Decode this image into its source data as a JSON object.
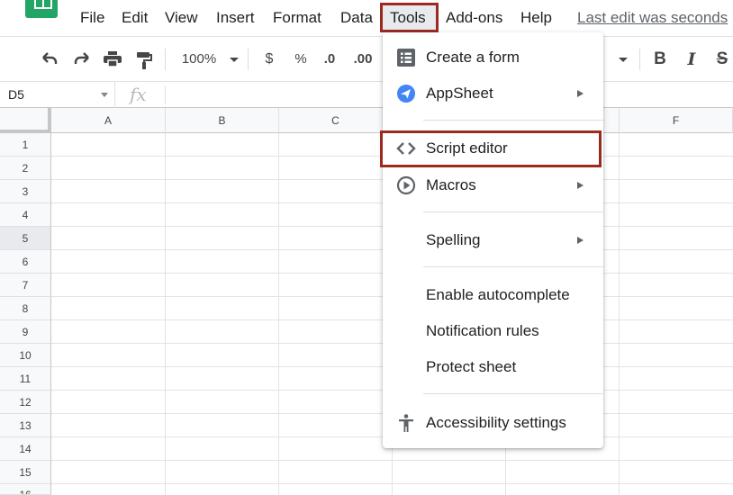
{
  "menubar": {
    "items": [
      "File",
      "Edit",
      "View",
      "Insert",
      "Format",
      "Data",
      "Tools",
      "Add-ons",
      "Help"
    ],
    "last_edit": "Last edit was seconds"
  },
  "toolbar": {
    "zoom": "100%",
    "currency": "$",
    "percent": "%",
    "decrease_decimal": ".0",
    "increase_decimal": ".00",
    "bold": "B",
    "italic": "I",
    "strike": "S"
  },
  "formula_bar": {
    "cell_ref": "D5",
    "fx": "fx"
  },
  "grid": {
    "columns": [
      "A",
      "B",
      "C",
      "F"
    ],
    "rows": [
      "1",
      "2",
      "3",
      "4",
      "5",
      "6",
      "7",
      "8",
      "9",
      "10",
      "11",
      "12",
      "13",
      "14",
      "15",
      "16"
    ],
    "active_row": "5"
  },
  "tools_menu": {
    "create_form": "Create a form",
    "appsheet": "AppSheet",
    "script_editor": "Script editor",
    "macros": "Macros",
    "spelling": "Spelling",
    "enable_autocomplete": "Enable autocomplete",
    "notification_rules": "Notification rules",
    "protect_sheet": "Protect sheet",
    "accessibility_settings": "Accessibility settings"
  },
  "colors": {
    "highlight_border": "#9b2a1f",
    "sheets_green": "#23a566",
    "appsheet_blue": "#4285f4"
  }
}
